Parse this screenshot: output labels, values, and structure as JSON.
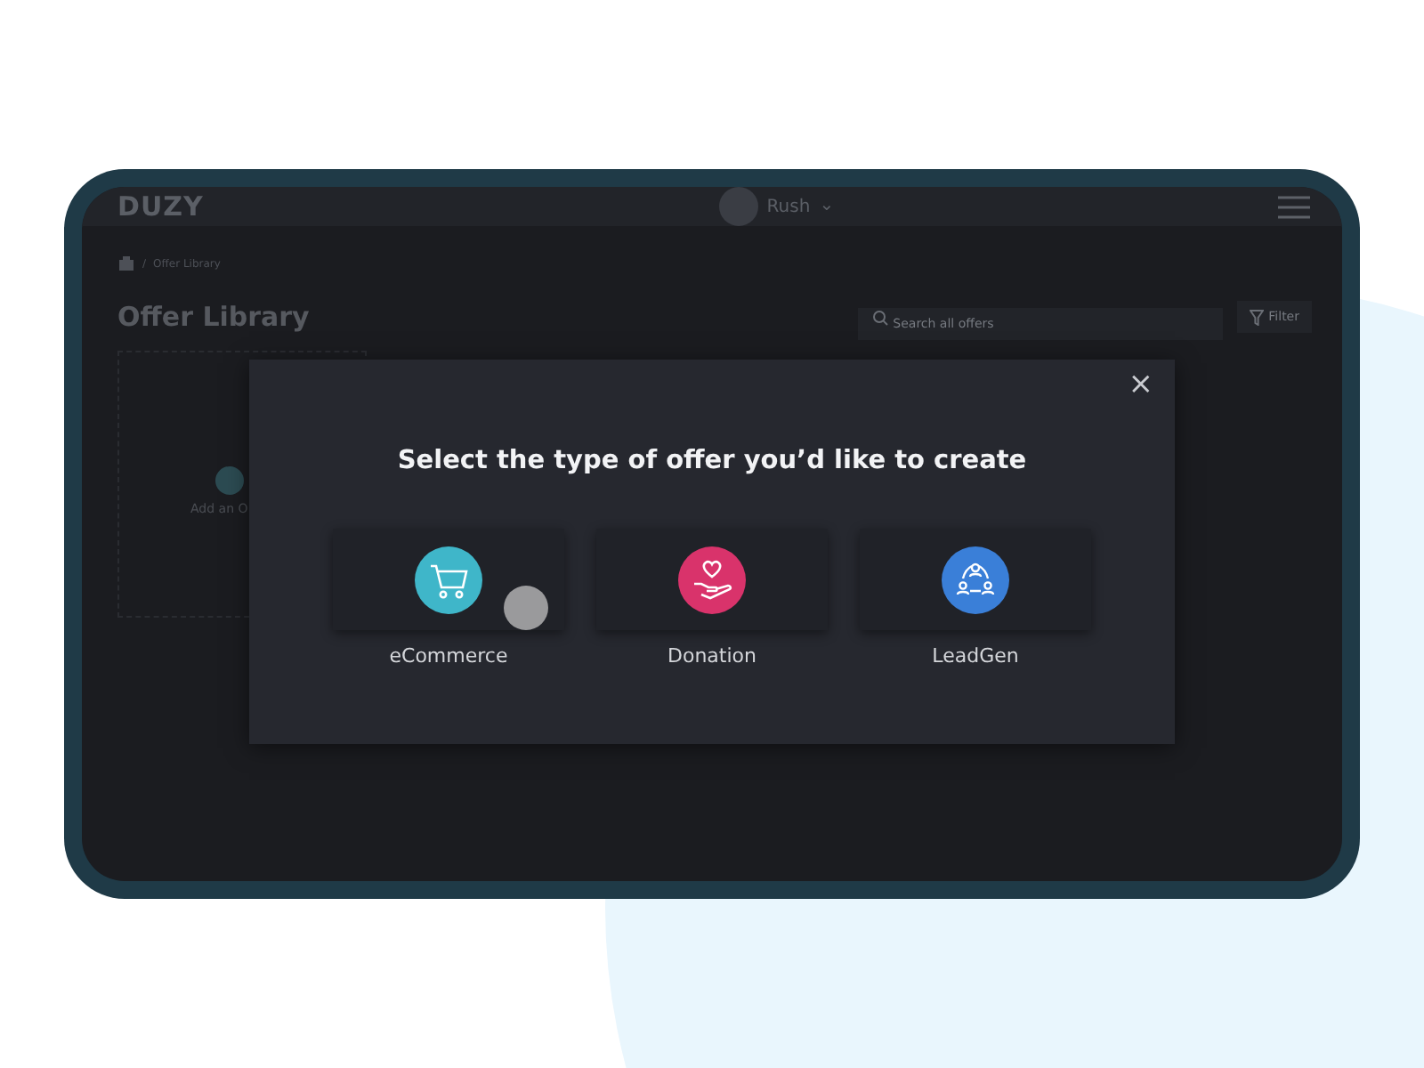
{
  "app": {
    "logo": "DUZY",
    "user": {
      "name": "Rush",
      "caret": "⌄"
    }
  },
  "breadcrumb": {
    "separator": "/",
    "current": "Offer Library"
  },
  "page": {
    "title": "Offer Library",
    "search": {
      "placeholder": "Search all offers"
    },
    "filter_button": "Filter",
    "add_card": "Add an O"
  },
  "modal": {
    "title": "Select the type of offer you’d like to create",
    "close": "×",
    "options": [
      {
        "kind": "ecommerce",
        "label": "eCommerce",
        "color": "#3fb6c9"
      },
      {
        "kind": "donation",
        "label": "Donation",
        "color": "#d9336b"
      },
      {
        "kind": "leadgen",
        "label": "LeadGen",
        "color": "#3a7fd8"
      }
    ]
  }
}
